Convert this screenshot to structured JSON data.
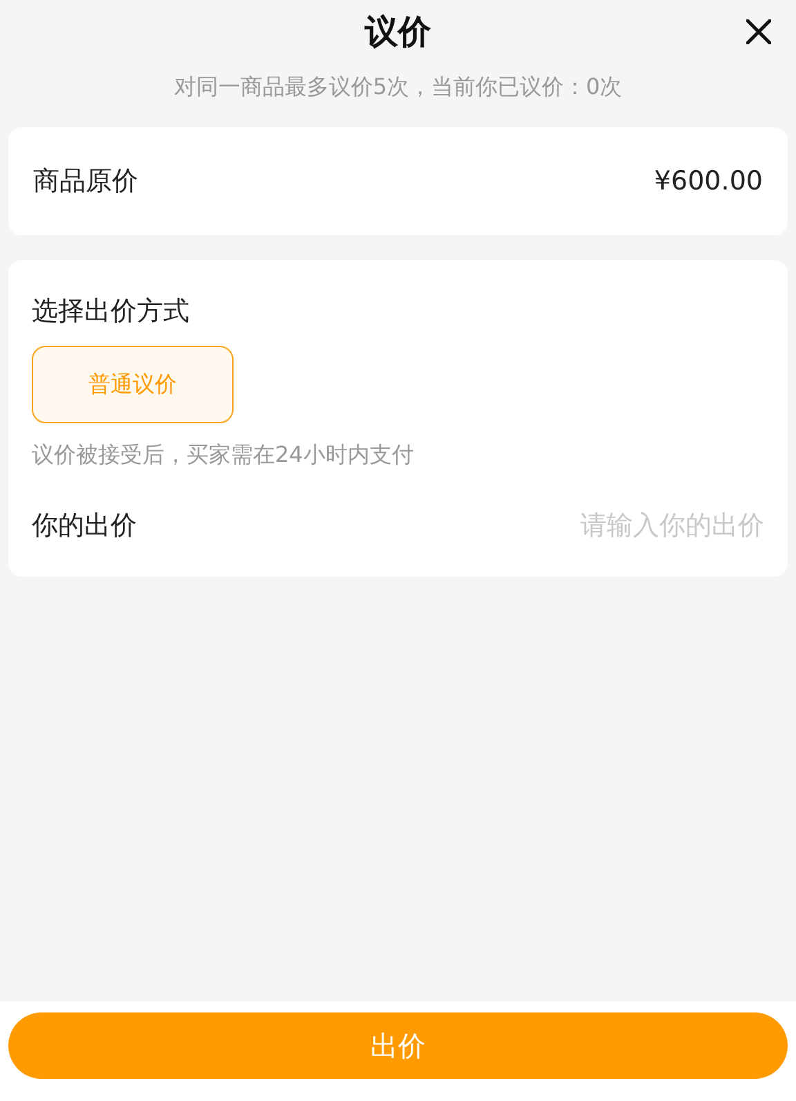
{
  "header": {
    "title": "议价",
    "subtitle": "对同一商品最多议价5次，当前你已议价：0次"
  },
  "original_price": {
    "label": "商品原价",
    "value": "¥600.00"
  },
  "offer_section": {
    "label": "选择出价方式",
    "options": [
      {
        "label": "普通议价",
        "selected": true
      }
    ],
    "note": "议价被接受后，买家需在24小时内支付",
    "your_offer": {
      "label": "你的出价",
      "placeholder": "请输入你的出价"
    }
  },
  "submit_button": "出价"
}
